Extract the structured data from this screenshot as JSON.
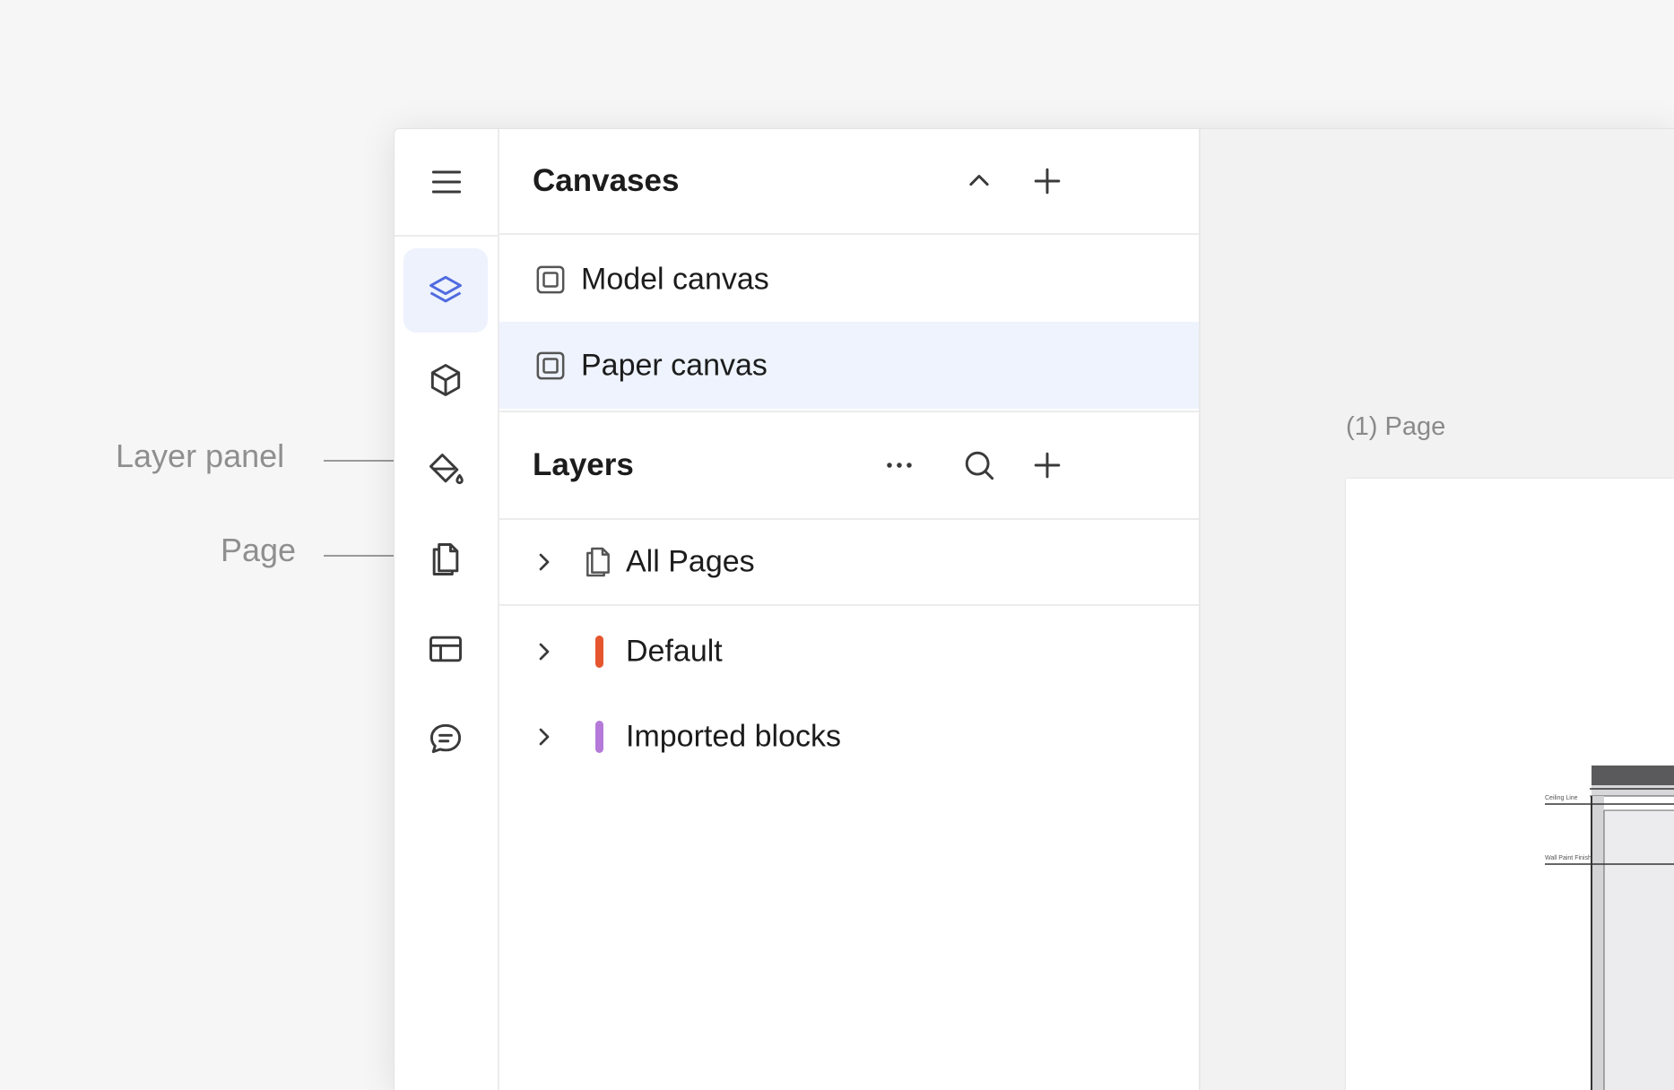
{
  "annotations": {
    "layer_panel": "Layer panel",
    "page": "Page"
  },
  "canvases": {
    "title": "Canvases",
    "items": [
      {
        "label": "Model canvas",
        "selected": false
      },
      {
        "label": "Paper canvas",
        "selected": true
      }
    ]
  },
  "layers": {
    "title": "Layers",
    "items": [
      {
        "label": "All Pages",
        "icon": "pages-icon"
      },
      {
        "label": "Default",
        "color": "#e5562f"
      },
      {
        "label": "Imported blocks",
        "color": "#b57ad9"
      }
    ]
  },
  "canvas_area": {
    "page_label": "(1) Page",
    "drawing_labels": [
      "Ceiling Line",
      "Wall Paint Finish"
    ]
  },
  "rail": {
    "items": [
      "layers-icon",
      "cube-icon",
      "paint-bucket-icon",
      "pages-icon",
      "table-icon",
      "chat-icon"
    ],
    "active": "layers-icon"
  },
  "colors": {
    "accent": "#4f6bdf",
    "selected_bg": "#eef3fd",
    "icon_gray": "#3a3a3a"
  }
}
